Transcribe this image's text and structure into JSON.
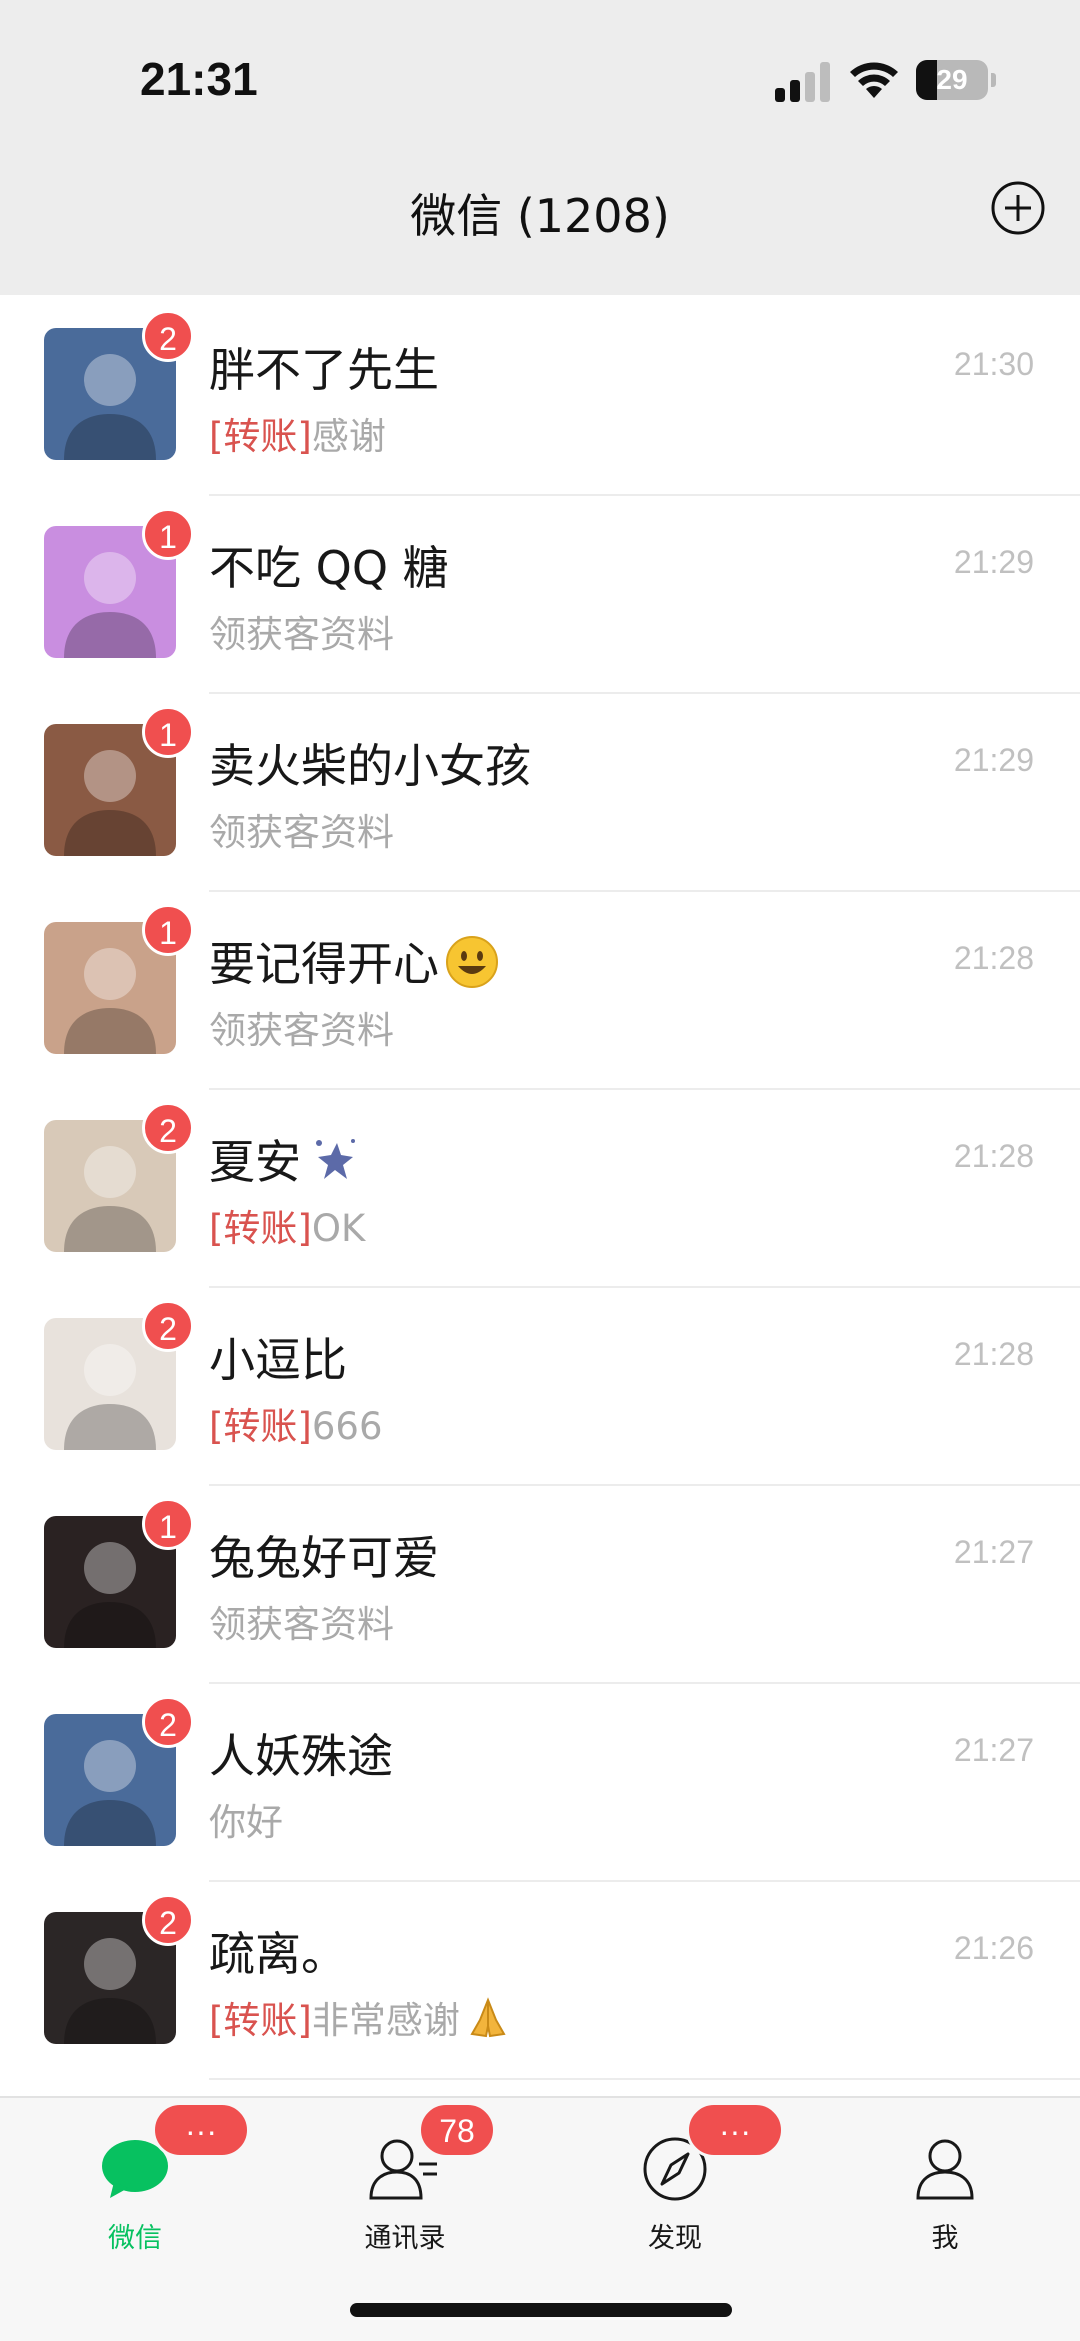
{
  "status_bar": {
    "time": "21:31",
    "battery_percent": "29",
    "battery_level": 0.29,
    "signal_bars": 2
  },
  "header": {
    "title": "微信 (1208)",
    "add_icon": "plus-circle-icon"
  },
  "chats": [
    {
      "name": "胖不了先生",
      "time": "21:30",
      "badge": "2",
      "tag": "[转账]",
      "preview": "感谢",
      "avatar_color": "#4a6b9a"
    },
    {
      "name": "不吃 QQ 糖",
      "time": "21:29",
      "badge": "1",
      "tag": "",
      "preview": "领获客资料",
      "avatar_color": "#c98ee0"
    },
    {
      "name": "卖火柴的小女孩",
      "time": "21:29",
      "badge": "1",
      "tag": "",
      "preview": "领获客资料",
      "avatar_color": "#8a5a44"
    },
    {
      "name": "要记得开心",
      "time": "21:28",
      "badge": "1",
      "tag": "",
      "preview": "领获客资料",
      "avatar_color": "#c9a28a",
      "emoji": "smiley-emoji"
    },
    {
      "name": "夏安",
      "time": "21:28",
      "badge": "2",
      "tag": "[转账]",
      "preview": "OK",
      "avatar_color": "#d8c9b8",
      "emoji": "sparkle-emoji"
    },
    {
      "name": "小逗比",
      "time": "21:28",
      "badge": "2",
      "tag": "[转账]",
      "preview": "666",
      "avatar_color": "#e8e2dc"
    },
    {
      "name": "兔兔好可爱",
      "time": "21:27",
      "badge": "1",
      "tag": "",
      "preview": "领获客资料",
      "avatar_color": "#2a2222"
    },
    {
      "name": "人妖殊途",
      "time": "21:27",
      "badge": "2",
      "tag": "",
      "preview": "你好",
      "avatar_color": "#4a6b9a"
    },
    {
      "name": "疏离。",
      "time": "21:26",
      "badge": "2",
      "tag": "[转账]",
      "preview": "非常感谢",
      "avatar_color": "#2b2626",
      "preview_emoji": "pray-emoji"
    }
  ],
  "tabbar": {
    "tabs": [
      {
        "label": "微信",
        "icon": "chat-bubble-icon",
        "badge": "···",
        "active": true
      },
      {
        "label": "通讯录",
        "icon": "contacts-icon",
        "badge": "78",
        "active": false
      },
      {
        "label": "发现",
        "icon": "compass-icon",
        "badge": "···",
        "active": false
      },
      {
        "label": "我",
        "icon": "person-icon",
        "badge": "",
        "active": false
      }
    ]
  },
  "colors": {
    "accent": "#07c160",
    "badge": "#f04f4f",
    "transfer_tag": "#d9534f"
  }
}
